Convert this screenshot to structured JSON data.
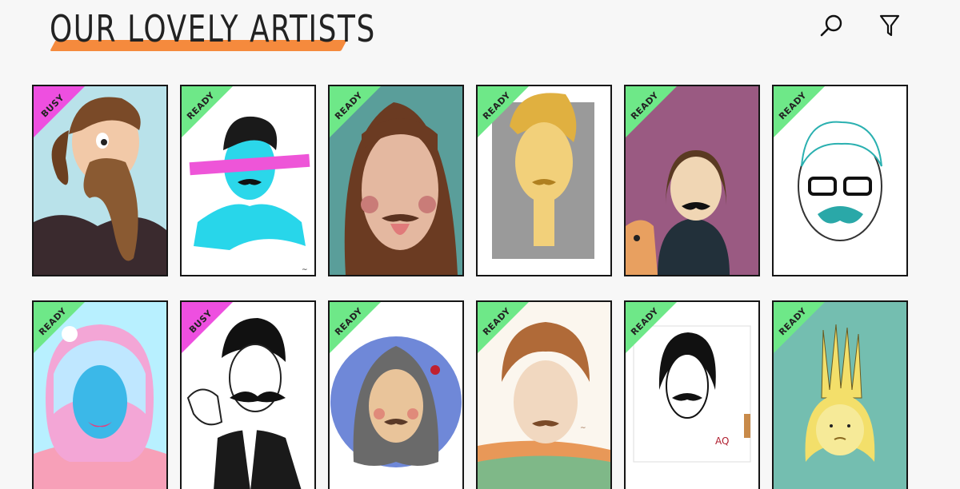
{
  "header": {
    "title": "OUR LOVELY ARTISTS",
    "search_icon": "search-icon",
    "filter_icon": "filter-icon"
  },
  "colors": {
    "accent_underline": "#f58a3d",
    "ready_ribbon": "#6ee888",
    "busy_ribbon": "#ee4fe0"
  },
  "artists": [
    {
      "status": "BUSY",
      "portrait": "ponytail-mustache-man"
    },
    {
      "status": "READY",
      "portrait": "pink-stripe-cyan-man"
    },
    {
      "status": "READY",
      "portrait": "long-hair-teal-background"
    },
    {
      "status": "READY",
      "portrait": "yellow-man-grey-panel"
    },
    {
      "status": "READY",
      "portrait": "woman-with-cat-purple"
    },
    {
      "status": "READY",
      "portrait": "glasses-teal-beard"
    },
    {
      "status": "READY",
      "portrait": "rainbow-hair-woman"
    },
    {
      "status": "BUSY",
      "portrait": "suit-twirled-mustache"
    },
    {
      "status": "READY",
      "portrait": "woman-circle-portrait"
    },
    {
      "status": "READY",
      "portrait": "watercolor-bob-hair"
    },
    {
      "status": "READY",
      "portrait": "ink-sketch-giraffe"
    },
    {
      "status": "READY",
      "portrait": "blonde-spiky-teal"
    }
  ]
}
